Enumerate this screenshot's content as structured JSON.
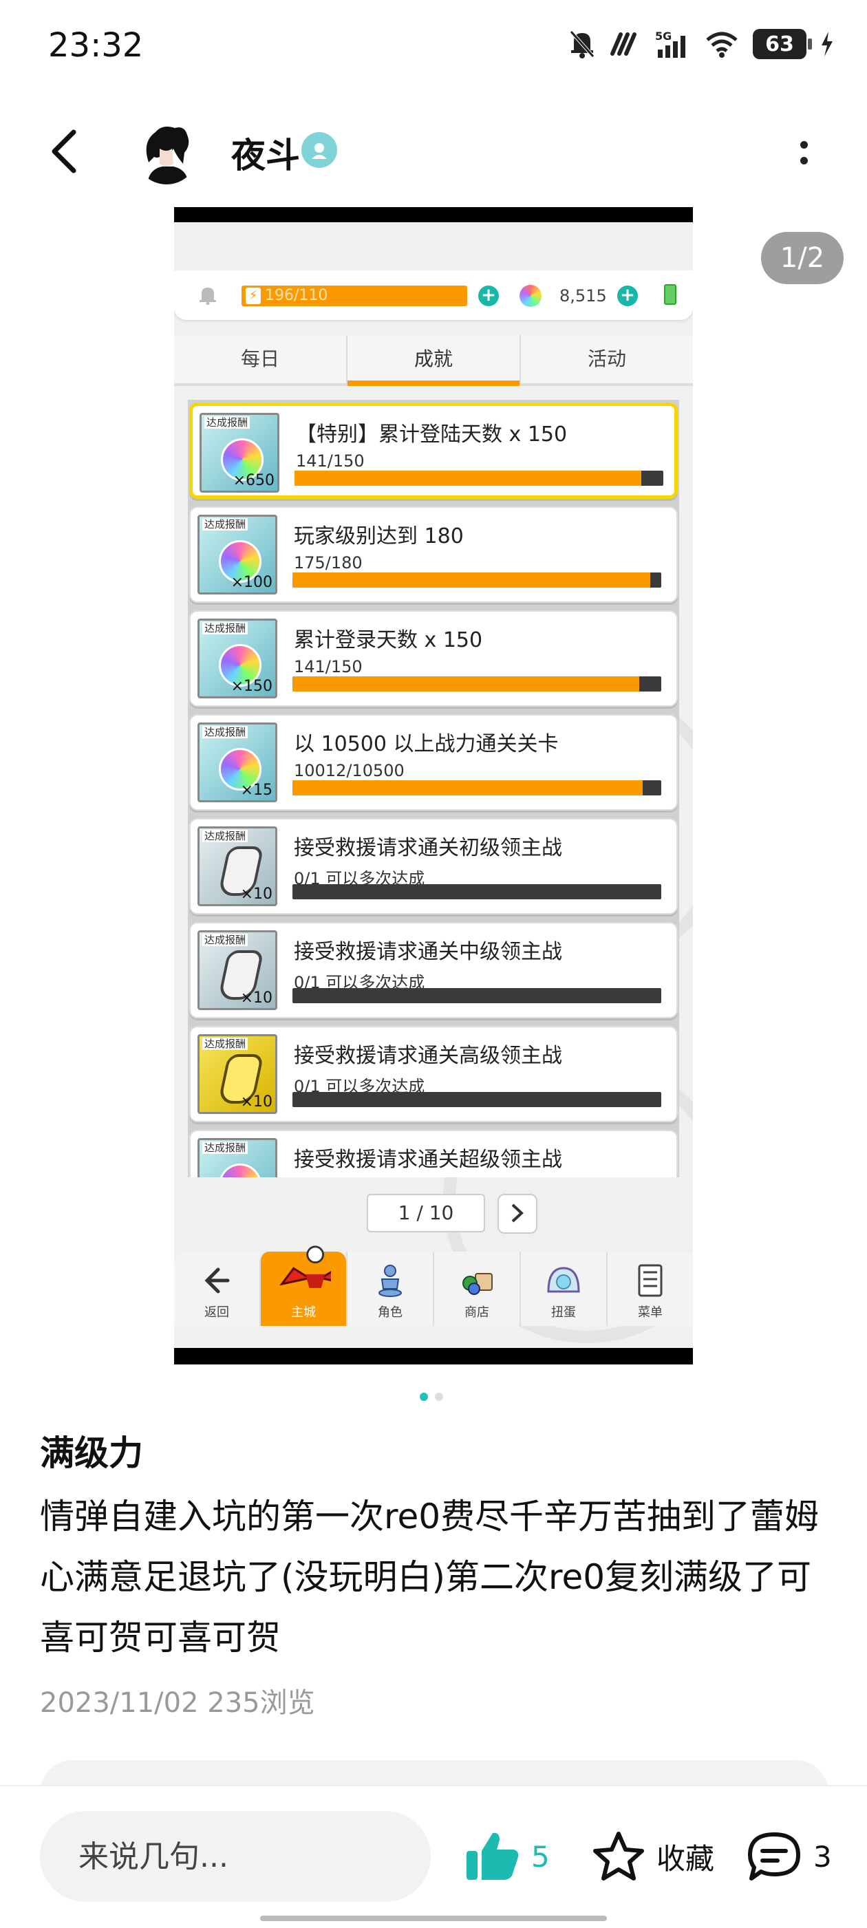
{
  "status_bar": {
    "time": "23:32",
    "battery": "63",
    "icons": [
      "mute-bell-icon",
      "nfc-icon",
      "signal-5g-icon",
      "wifi-icon",
      "battery-icon",
      "charging-icon"
    ]
  },
  "header": {
    "username": "夜斗",
    "back_icon": "chevron-left-icon",
    "verified_icon": "verified-badge-icon",
    "more_icon": "more-vertical-icon"
  },
  "image_viewer": {
    "page_indicator": "1/2",
    "dots": [
      true,
      false
    ]
  },
  "game_screen": {
    "stamina": "196/110",
    "gems": "8,515",
    "tabs": [
      {
        "label": "每日",
        "active": false
      },
      {
        "label": "成就",
        "active": true
      },
      {
        "label": "活动",
        "active": false
      }
    ],
    "achievements": [
      {
        "tag": "达成报酬",
        "qty": "×650",
        "title": "【特别】累计登陆天数  x 150",
        "progress": "141/150",
        "fill": 0.94,
        "reward": "orb",
        "highlight": true
      },
      {
        "tag": "达成报酬",
        "qty": "×100",
        "title": "玩家级别达到 180",
        "progress": "175/180",
        "fill": 0.97,
        "reward": "orb",
        "highlight": false
      },
      {
        "tag": "达成报酬",
        "qty": "×150",
        "title": "累计登录天数  x 150",
        "progress": "141/150",
        "fill": 0.94,
        "reward": "orb",
        "highlight": false
      },
      {
        "tag": "达成报酬",
        "qty": "×15",
        "title": "以 10500 以上战力通关关卡",
        "progress": "10012/10500",
        "fill": 0.95,
        "reward": "orb",
        "highlight": false
      },
      {
        "tag": "达成报酬",
        "qty": "×10",
        "title": "接受救援请求通关初级领主战",
        "progress": "0/1   可以多次达成",
        "fill": 0,
        "reward": "silver",
        "highlight": false
      },
      {
        "tag": "达成报酬",
        "qty": "×10",
        "title": "接受救援请求通关中级领主战",
        "progress": "0/1   可以多次达成",
        "fill": 0,
        "reward": "silver",
        "highlight": false
      },
      {
        "tag": "达成报酬",
        "qty": "×10",
        "title": "接受救援请求通关高级领主战",
        "progress": "0/1   可以多次达成",
        "fill": 0,
        "reward": "gold",
        "highlight": false
      },
      {
        "tag": "达成报酬",
        "qty": "",
        "title": "接受救援请求通关超级领主战",
        "progress": "",
        "fill": 0,
        "reward": "orb",
        "highlight": false
      }
    ],
    "pager": "1 / 10",
    "nav": [
      {
        "label": "返回",
        "icon": "arrow-left-icon",
        "active": false
      },
      {
        "label": "主城",
        "icon": "castle-icon",
        "active": true
      },
      {
        "label": "角色",
        "icon": "character-icon",
        "active": false
      },
      {
        "label": "商店",
        "icon": "shop-icon",
        "active": false
      },
      {
        "label": "扭蛋",
        "icon": "gacha-icon",
        "active": false
      },
      {
        "label": "菜单",
        "icon": "menu-icon",
        "active": false
      }
    ]
  },
  "post": {
    "title": "满级力",
    "body": "情弹自建入坑的第一次re0费尽千辛万苦抽到了蕾姆心满意足退坑了(没玩明白)第二次re0复刻满级了可喜可贺可喜可贺",
    "meta": "2023/11/02  235浏览"
  },
  "bottom_bar": {
    "comment_placeholder": "来说几句...",
    "like_count": "5",
    "favorite_label": "收藏",
    "comment_count": "3",
    "accent": "#1cbab0"
  }
}
